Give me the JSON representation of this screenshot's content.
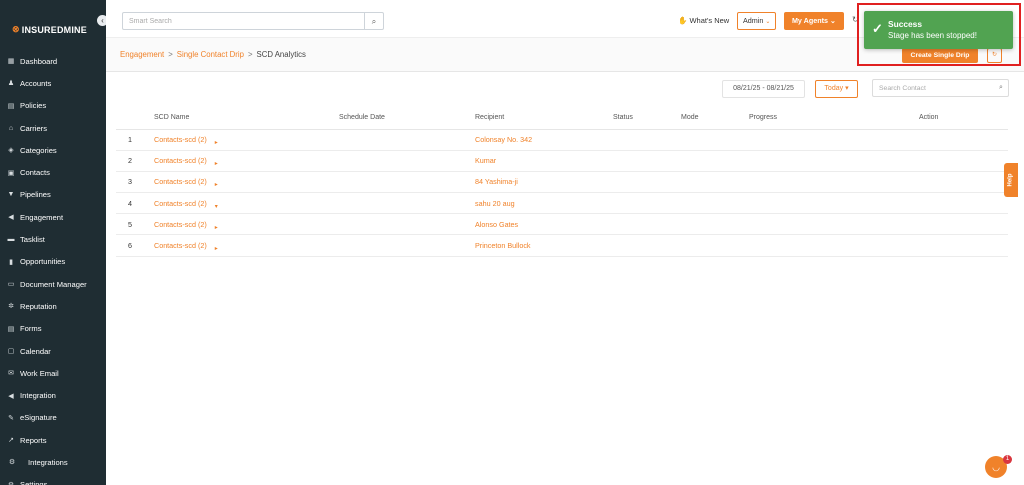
{
  "app": {
    "logo_text": "INSUREDMINE",
    "collapse_glyph": "‹"
  },
  "sidebar": {
    "items": [
      {
        "label": "Dashboard",
        "icon": "dashboard-icon",
        "glyph": "▦"
      },
      {
        "label": "Accounts",
        "icon": "accounts-icon",
        "glyph": "♟"
      },
      {
        "label": "Policies",
        "icon": "policies-icon",
        "glyph": "▤"
      },
      {
        "label": "Carriers",
        "icon": "carriers-icon",
        "glyph": "⌂"
      },
      {
        "label": "Categories",
        "icon": "categories-icon",
        "glyph": "◈"
      },
      {
        "label": "Contacts",
        "icon": "contacts-icon",
        "glyph": "▣"
      },
      {
        "label": "Pipelines",
        "icon": "pipelines-icon",
        "glyph": "▼"
      },
      {
        "label": "Engagement",
        "icon": "engagement-icon",
        "glyph": "◀"
      },
      {
        "label": "Tasklist",
        "icon": "tasklist-icon",
        "glyph": "▬"
      },
      {
        "label": "Opportunities",
        "icon": "opportunities-icon",
        "glyph": "▮"
      },
      {
        "label": "Document Manager",
        "icon": "folder-icon",
        "glyph": "▭"
      },
      {
        "label": "Reputation",
        "icon": "reputation-icon",
        "glyph": "✲"
      },
      {
        "label": "Forms",
        "icon": "forms-icon",
        "glyph": "▤"
      },
      {
        "label": "Calendar",
        "icon": "calendar-icon",
        "glyph": "▢"
      },
      {
        "label": "Work Email",
        "icon": "email-icon",
        "glyph": "✉"
      },
      {
        "label": "Integration",
        "icon": "integration-icon",
        "glyph": "◀"
      },
      {
        "label": "eSignature",
        "icon": "esignature-icon",
        "glyph": "✎"
      },
      {
        "label": "Reports",
        "icon": "reports-icon",
        "glyph": "↗"
      },
      {
        "label": "Integrations",
        "icon": "integrations-icon",
        "glyph": "⚙"
      },
      {
        "label": "Settings",
        "icon": "settings-icon",
        "glyph": "⚙"
      }
    ]
  },
  "topbar": {
    "search_placeholder": "Smart Search",
    "whats_new": "What's New",
    "admin_label": "Admin",
    "my_agents_label": "My Agents"
  },
  "breadcrumb": {
    "items": [
      "Engagement",
      "Single Contact Drip"
    ],
    "current": "SCD Analytics",
    "separator": ">"
  },
  "actions": {
    "create_label": "Create Single Drip"
  },
  "filters": {
    "date_range": "08/21/25 - 08/21/25",
    "today_label": "Today",
    "contact_search_placeholder": "Search Contact"
  },
  "table": {
    "columns": [
      "SCD Name",
      "Schedule Date",
      "Recipient",
      "Status",
      "Mode",
      "Progress",
      "Action"
    ],
    "rows": [
      {
        "index": "1",
        "name": "Contacts-scd (2)",
        "caret": "▸",
        "schedule_date": "",
        "recipient": "Colonsay No. 342",
        "status": "",
        "mode": "",
        "progress": "",
        "action": ""
      },
      {
        "index": "2",
        "name": "Contacts-scd (2)",
        "caret": "▸",
        "schedule_date": "",
        "recipient": "Kumar",
        "status": "",
        "mode": "",
        "progress": "",
        "action": ""
      },
      {
        "index": "3",
        "name": "Contacts-scd (2)",
        "caret": "▸",
        "schedule_date": "",
        "recipient": "84 Yashima-ji",
        "status": "",
        "mode": "",
        "progress": "",
        "action": ""
      },
      {
        "index": "4",
        "name": "Contacts-scd (2)",
        "caret": "▾",
        "schedule_date": "",
        "recipient": "sahu 20 aug",
        "status": "",
        "mode": "",
        "progress": "",
        "action": ""
      },
      {
        "index": "5",
        "name": "Contacts-scd (2)",
        "caret": "▸",
        "schedule_date": "",
        "recipient": "Alonso Gates",
        "status": "",
        "mode": "",
        "progress": "",
        "action": ""
      },
      {
        "index": "6",
        "name": "Contacts-scd (2)",
        "caret": "▸",
        "schedule_date": "",
        "recipient": "Princeton Bullock",
        "status": "",
        "mode": "",
        "progress": "",
        "action": ""
      }
    ]
  },
  "help_tab": "Help",
  "chat": {
    "badge_count": "1"
  },
  "toast": {
    "title": "Success",
    "message": "Stage has been stopped!",
    "color": "#51a351"
  },
  "colors": {
    "accent": "#f0822a",
    "sidebar_bg": "#1f2d33",
    "highlight_frame": "#e02020"
  }
}
